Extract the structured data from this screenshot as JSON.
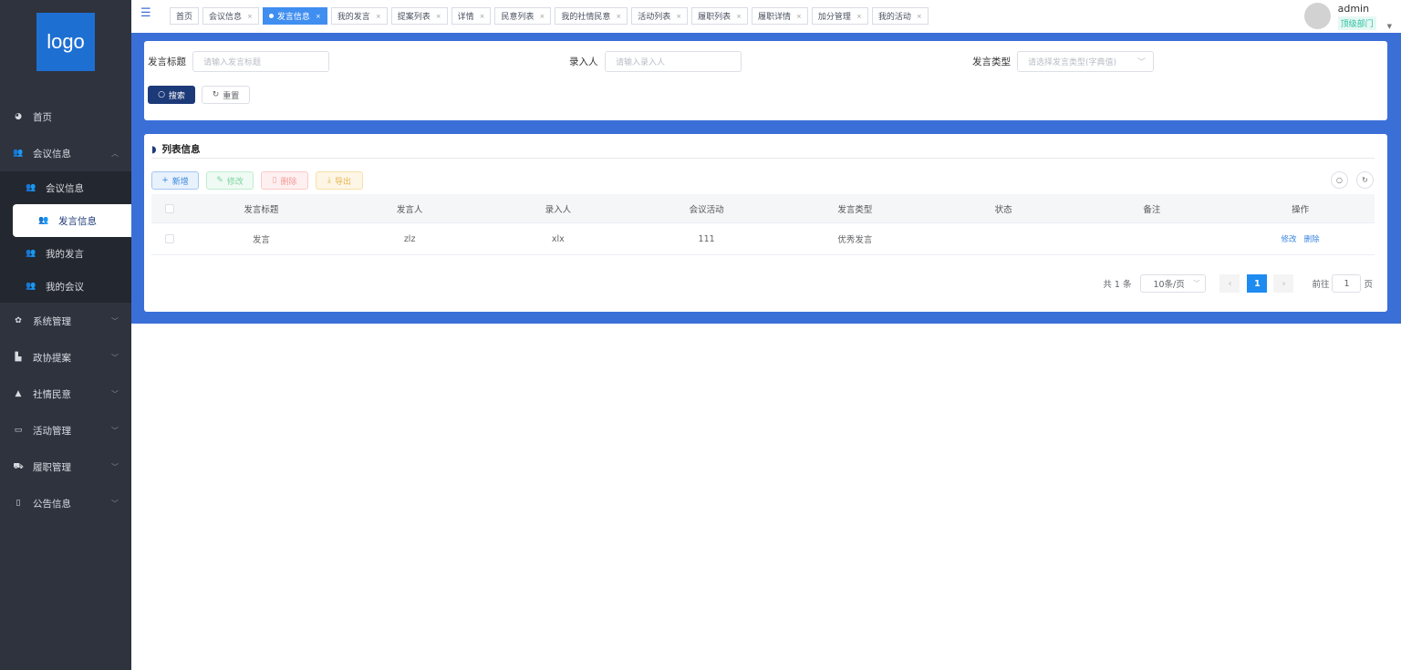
{
  "sidebar": {
    "logo": "logo",
    "items": [
      {
        "label": "首页",
        "icon": "dashboard-icon"
      },
      {
        "label": "会议信息",
        "icon": "users-icon",
        "expanded": true,
        "children": [
          {
            "label": "会议信息"
          },
          {
            "label": "发言信息",
            "active": true
          },
          {
            "label": "我的发言"
          },
          {
            "label": "我的会议"
          }
        ]
      },
      {
        "label": "系统管理",
        "icon": "gear-icon"
      },
      {
        "label": "政协提案",
        "icon": "documents-icon"
      },
      {
        "label": "社情民意",
        "icon": "user-icon"
      },
      {
        "label": "活动管理",
        "icon": "monitor-icon"
      },
      {
        "label": "履职管理",
        "icon": "car-icon"
      },
      {
        "label": "公告信息",
        "icon": "phone-icon"
      }
    ]
  },
  "tabs": [
    "首页",
    "会议信息",
    "发言信息",
    "我的发言",
    "提案列表",
    "详情",
    "民意列表",
    "我的社情民意",
    "活动列表",
    "履职列表",
    "履职详情",
    "加分管理",
    "我的活动"
  ],
  "active_tab": "发言信息",
  "user": {
    "name": "admin",
    "dept": "顶级部门"
  },
  "search": {
    "title_label": "发言标题",
    "title_placeholder": "请输入发言标题",
    "entry_label": "录入人",
    "entry_placeholder": "请输入录入人",
    "type_label": "发言类型",
    "type_placeholder": "请选择发言类型(字典值)",
    "search_btn": "搜索",
    "reset_btn": "重置"
  },
  "list": {
    "title": "列表信息",
    "add": "新增",
    "edit": "修改",
    "delete": "删除",
    "export": "导出",
    "columns": [
      "发言标题",
      "发言人",
      "录入人",
      "会议活动",
      "发言类型",
      "状态",
      "备注",
      "操作"
    ],
    "rows": [
      {
        "title": "发言",
        "speaker": "zlz",
        "entry": "xlx",
        "activity": "111",
        "type": "优秀发言",
        "status": "",
        "remark": "",
        "edit": "修改",
        "delete": "删除"
      }
    ]
  },
  "pagination": {
    "total": "共 1 条",
    "page_size": "10条/页",
    "current": "1",
    "goto": "前往",
    "goto_value": "1",
    "page_unit": "页"
  },
  "colors": {
    "sidebar": "#2e333e",
    "accent": "#3a6fd8",
    "primary_btn": "#1d3a78",
    "active_tab": "#3f8ef0"
  }
}
